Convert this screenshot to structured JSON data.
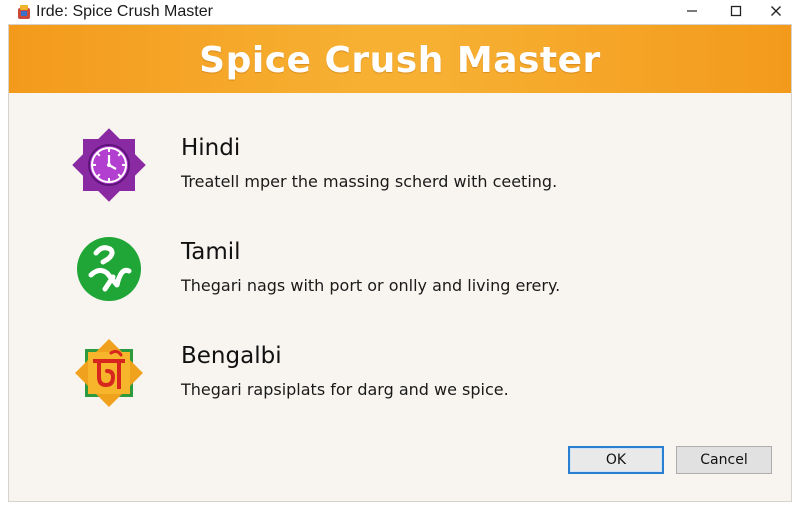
{
  "window": {
    "title": "Irde: Spice Crush Master"
  },
  "banner": {
    "title": "Spice Crush Master",
    "gradient_from": "#f39a1c",
    "gradient_to": "#f7b032"
  },
  "options": [
    {
      "name": "Hindi",
      "description": "Treatell mper the massing scherd with ceeting.",
      "icon": "purple-star-clock-icon",
      "color": "#8a2aa3"
    },
    {
      "name": "Tamil",
      "description": "Thegari nags with port or onlly and living erery.",
      "icon": "green-circle-tamil-script-icon",
      "color": "#1fa637"
    },
    {
      "name": "Bengalbi",
      "description": "Thegari rapsiplats for darg and we spice.",
      "icon": "orange-star-bengali-script-icon",
      "color": "#f0a21e"
    }
  ],
  "buttons": {
    "ok_label": "OK",
    "cancel_label": "Cancel"
  },
  "colors": {
    "frame_background": "#f8f5f0",
    "ok_focus_border": "#2b7fd1"
  }
}
